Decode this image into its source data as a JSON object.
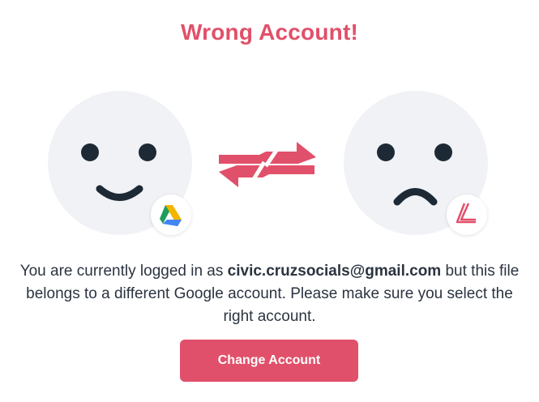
{
  "title": "Wrong Account!",
  "message": {
    "prefix": "You are currently logged in as ",
    "email": "civic.cruzsocials@gmail.com",
    "suffix": " but this file belongs to a different Google account. Please make sure you select the right account."
  },
  "button": {
    "label": "Change Account"
  },
  "icons": {
    "left_face": "happy-face-icon",
    "right_face": "sad-face-icon",
    "left_badge": "google-drive-icon",
    "right_badge": "app-logo-icon",
    "swap": "swap-arrows-icon"
  },
  "colors": {
    "accent": "#e1506a",
    "text": "#2b3440",
    "face_bg": "#f0f2f5",
    "face_features": "#1d2a36"
  }
}
